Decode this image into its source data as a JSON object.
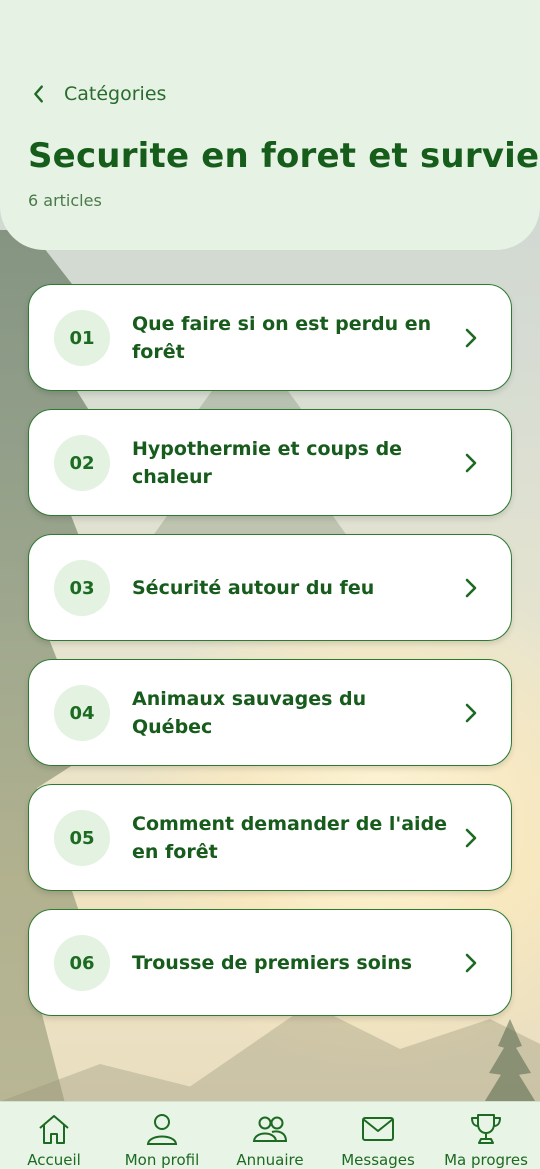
{
  "header": {
    "back_label": "Catégories",
    "title": "Securite en foret et survie",
    "count": "6 articles"
  },
  "articles": [
    {
      "number": "01",
      "title": "Que faire si on est perdu en forêt"
    },
    {
      "number": "02",
      "title": "Hypothermie et coups de chaleur"
    },
    {
      "number": "03",
      "title": "Sécurité autour du feu"
    },
    {
      "number": "04",
      "title": "Animaux sauvages du Québec"
    },
    {
      "number": "05",
      "title": "Comment demander de l'aide en forêt"
    },
    {
      "number": "06",
      "title": "Trousse de premiers soins"
    }
  ],
  "tabs": [
    {
      "label": "Accueil",
      "icon": "home-icon"
    },
    {
      "label": "Mon profil",
      "icon": "user-icon"
    },
    {
      "label": "Annuaire",
      "icon": "users-icon"
    },
    {
      "label": "Messages",
      "icon": "mail-icon"
    },
    {
      "label": "Ma progres",
      "icon": "trophy-icon"
    }
  ],
  "colors": {
    "primary": "#165c1b",
    "header_bg": "#e6f3e4",
    "card_border": "#2f7a33",
    "number_bg": "#e3f2e1"
  }
}
